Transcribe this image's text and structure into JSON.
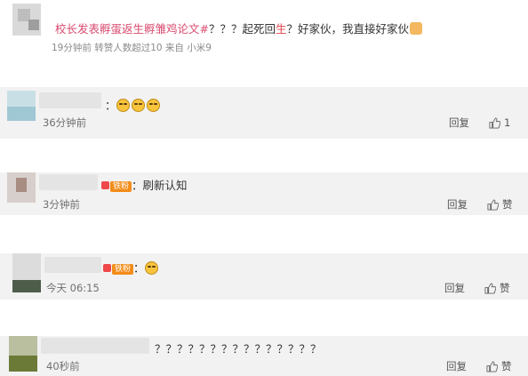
{
  "post": {
    "link_text": "校长发表孵蛋返生孵雏鸡论文#",
    "text_a": "？？？起死回",
    "text_red": "生",
    "text_b": "？好家伙，我直接好家伙",
    "meta": "19分钟前  转赞人数超过10  来自 小米9"
  },
  "comments": [
    {
      "time": "36分钟前",
      "text": "：",
      "reply": "回复",
      "likes": "1"
    },
    {
      "time": "3分钟前",
      "badge": "铁粉",
      "text": "：刷新认知",
      "reply": "回复",
      "likes": "赞"
    },
    {
      "time": "今天 06:15",
      "badge": "铁粉",
      "text": "：",
      "reply": "回复",
      "likes": "赞"
    },
    {
      "time": "40秒前",
      "text": "？？？？？？？？？？？？？？？",
      "reply": "回复",
      "likes": "赞"
    }
  ],
  "icons": {
    "like": "thumbs-up-icon",
    "emoji": "smile-emoji-icon",
    "thumb_emoji": "thumbs-up-emoji-icon"
  },
  "colors": {
    "link": "#d94a6e",
    "badge": "#f38c1a",
    "background": "#f2f2f2"
  }
}
